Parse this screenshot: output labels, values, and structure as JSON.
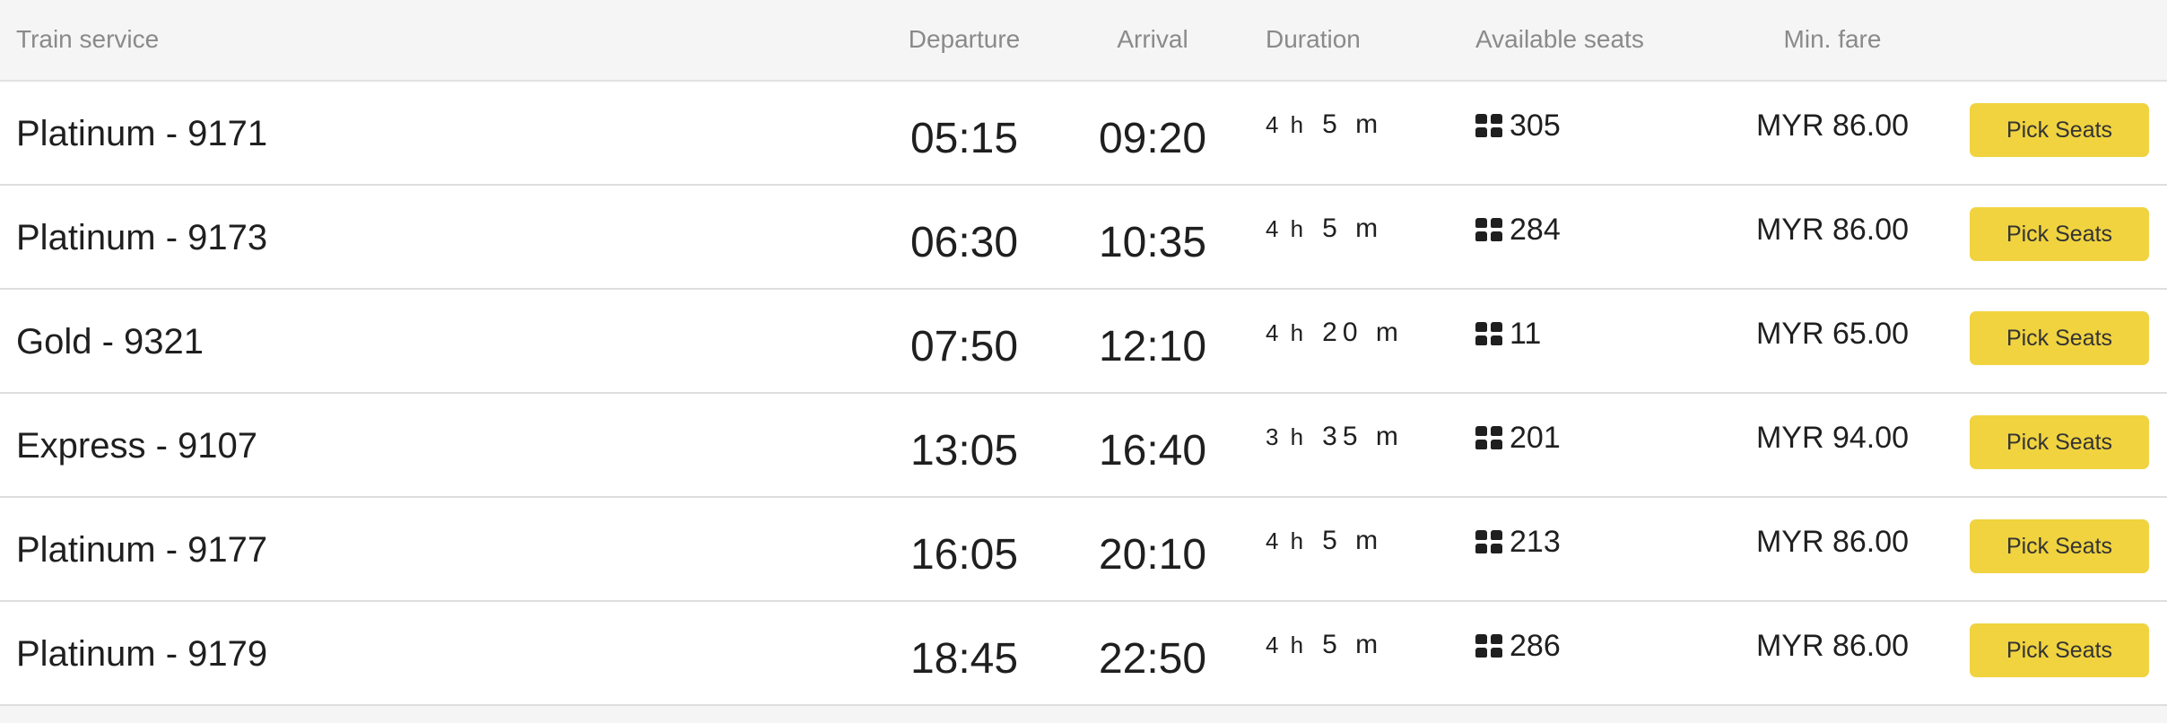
{
  "header": {
    "train_service": "Train service",
    "departure": "Departure",
    "arrival": "Arrival",
    "duration": "Duration",
    "available_seats": "Available seats",
    "min_fare": "Min. fare"
  },
  "rows": [
    {
      "service": "Platinum - 9171",
      "departure": "05:15",
      "arrival": "09:20",
      "duration_h": "4 h",
      "duration_m": "5 m",
      "seats": "305",
      "fare": "MYR 86.00",
      "button": "Pick Seats"
    },
    {
      "service": "Platinum - 9173",
      "departure": "06:30",
      "arrival": "10:35",
      "duration_h": "4 h",
      "duration_m": "5 m",
      "seats": "284",
      "fare": "MYR 86.00",
      "button": "Pick Seats"
    },
    {
      "service": "Gold - 9321",
      "departure": "07:50",
      "arrival": "12:10",
      "duration_h": "4 h",
      "duration_m": "20 m",
      "seats": "11",
      "fare": "MYR 65.00",
      "button": "Pick Seats"
    },
    {
      "service": "Express - 9107",
      "departure": "13:05",
      "arrival": "16:40",
      "duration_h": "3 h",
      "duration_m": "35 m",
      "seats": "201",
      "fare": "MYR 94.00",
      "button": "Pick Seats"
    },
    {
      "service": "Platinum - 9177",
      "departure": "16:05",
      "arrival": "20:10",
      "duration_h": "4 h",
      "duration_m": "5 m",
      "seats": "213",
      "fare": "MYR 86.00",
      "button": "Pick Seats"
    },
    {
      "service": "Platinum - 9179",
      "departure": "18:45",
      "arrival": "22:50",
      "duration_h": "4 h",
      "duration_m": "5 m",
      "seats": "286",
      "fare": "MYR 86.00",
      "button": "Pick Seats"
    }
  ],
  "icons": {
    "seats": "seat-grid-icon"
  },
  "colors": {
    "button_bg": "#f0d33f",
    "header_bg": "#f5f5f5",
    "header_text": "#8a8a8a"
  }
}
